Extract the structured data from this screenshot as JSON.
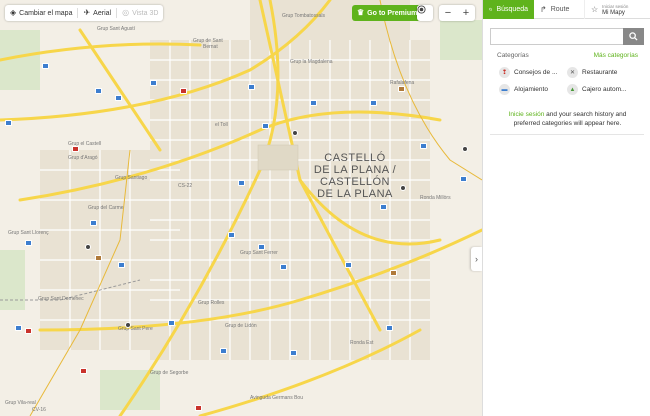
{
  "map": {
    "controls": {
      "change_map": "Cambiar el mapa",
      "aerial": "Aerial",
      "third": "Vista 3D"
    },
    "premium": "Go to Premium",
    "zoom_out": "−",
    "zoom_in": "+",
    "collapse": "›",
    "city_label": [
      "CASTELLÓ",
      "DE LA PLANA /",
      "CASTELLÓN",
      "DE LA PLANA"
    ],
    "labels": [
      "Grup Tombatossals",
      "Grup de Sant",
      "Bernat",
      "Grup la Magdalena",
      "Grup Sant Agustí",
      "Rafalafena",
      "el Toll",
      "Grup el Castell",
      "Grup d'Aragó",
      "Grup Santiago",
      "Grup del Carme",
      "Grup Sant Llorenç",
      "Grup Sant Domenec",
      "Grup de Lidón",
      "Grup Sant Ferrer",
      "Grup Sant Pere",
      "Grup de Segorbe",
      "Grup Vila-real",
      "Ronda Millòrs",
      "Ronda Est",
      "Avinguda Germans Bou",
      "CS-22",
      "CV-16",
      "Grup Rolles"
    ]
  },
  "sidebar": {
    "tabs": {
      "search": "Búsqueda",
      "route": "Route",
      "login_small": "Iniciar sesión",
      "login_big": "Mi Mapy"
    },
    "search_placeholder": "",
    "categories_title": "Categorías",
    "more_categories": "Más categorías",
    "categories": [
      {
        "label": "Consejos de ...",
        "icon": "tips-icon"
      },
      {
        "label": "Restaurante",
        "icon": "restaurant-icon"
      },
      {
        "label": "Alojamiento",
        "icon": "bed-icon"
      },
      {
        "label": "Cajero autom...",
        "icon": "atm-icon"
      }
    ],
    "login_link": "Inicie sesión",
    "login_rest": " and your search history and preferred categories will appear here."
  },
  "colors": {
    "accent": "#5fb31c",
    "road_major": "#f7d64a",
    "poi_blue": "#3d7ecf"
  }
}
